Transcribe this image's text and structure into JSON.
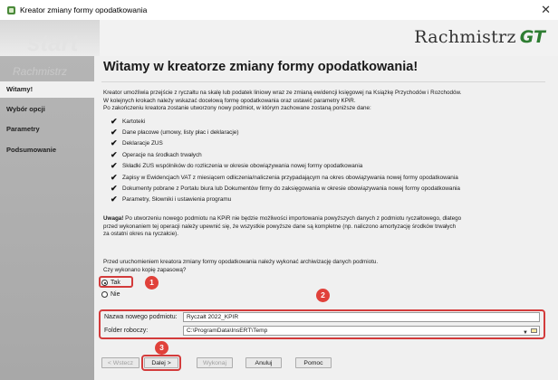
{
  "window": {
    "title": "Kreator zmiany formy opodatkowania",
    "close": "✕"
  },
  "banner": {
    "logo_text": "Rachmistrz",
    "logo_gt": "GT",
    "watermark_top": "start",
    "watermark_bottom": "Rachmistrz"
  },
  "sidebar": {
    "items": [
      {
        "label": "Witamy!",
        "active": true
      },
      {
        "label": "Wybór opcji",
        "active": false
      },
      {
        "label": "Parametry",
        "active": false
      },
      {
        "label": "Podsumowanie",
        "active": false
      }
    ]
  },
  "main": {
    "heading": "Witamy w kreatorze zmiany formy opodatkowania!",
    "intro": [
      "Kreator umożliwia przejście z ryczałtu na skalę lub podatek liniowy wraz ze zmianą ewidencji księgowej na Książkę Przychodów i Rozchodów.",
      "W kolejnych krokach należy wskazać docelową formę opodatkowania oraz ustawić parametry KPiR.",
      "Po zakończeniu kreatora zostanie utworzony nowy podmiot, w którym zachowane zostaną poniższe dane:"
    ],
    "checklist": [
      "Kartoteki",
      "Dane płacowe (umowy, listy płac i deklaracje)",
      "Deklaracje ZUS",
      "Operacje na środkach trwałych",
      "Składki ZUS wspólników do rozliczenia w okresie obowiązywania nowej formy opodatkowania",
      "Zapisy w Ewidencjach VAT z miesiącem odliczenia/naliczenia przypadającym na okres obowiązywania nowej formy opodatkowania",
      "Dokumenty pobrane z Portalu biura lub Dokumentów firmy do zaksięgowania w okresie obowiązywania nowej formy opodatkowania",
      "Parametry, Słowniki i ustawienia programu"
    ],
    "warning_label": "Uwaga!",
    "warning": [
      " Po utworzeniu nowego podmiotu na KPiR nie będzie możliwości importowania powyższych danych z podmiotu ryczałtowego, dlatego",
      "przed wykonaniem tej operacji należy upewnić się, że wszystkie powyższe dane są kompletne (np. naliczono amortyzację środków trwałych",
      "za ostatni okres na ryczałcie)."
    ],
    "backup": [
      "Przed uruchomieniem kreatora zmiany formy opodatkowania należy wykonać archiwizację danych podmiotu.",
      "Czy wykonano kopię zapasową?"
    ],
    "radio_yes": "Tak",
    "radio_no": "Nie",
    "selected": "Tak",
    "name_label": "Nazwa nowego podmiotu:",
    "name_value": "Ryczałt 2022_KPIR",
    "folder_label": "Folder roboczy:",
    "folder_value": "C:\\ProgramData\\InsERT\\Temp"
  },
  "badges": [
    "1",
    "2",
    "3"
  ],
  "buttons": {
    "back": "< Wstecz",
    "next": "Dalej >",
    "run": "Wykonaj",
    "cancel": "Anuluj",
    "help": "Pomoc"
  },
  "colors": {
    "highlight": "#d33b3b",
    "badge": "#e0413a",
    "brand_green": "#2e7d32"
  }
}
